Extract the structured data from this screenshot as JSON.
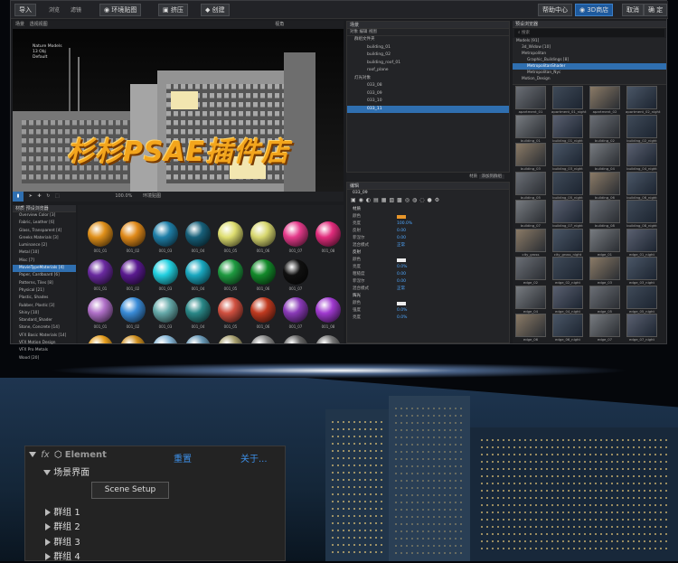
{
  "topbar": {
    "import": "导入",
    "browse": "浏览",
    "filter": "滤镜",
    "env": "环境贴图",
    "extrude": "挤压",
    "create": "创建",
    "help": "帮助中心",
    "store": "3D商店",
    "cancel": "取消",
    "ok": "确 定"
  },
  "viewport": {
    "tab": "场景",
    "mode": "透视视图",
    "bar": "视角",
    "zoom": "100.0%",
    "env": "环境贴图",
    "info1": "Nature Models",
    "info2": "13 Obj",
    "info3": "Default",
    "banner": "杉杉PSAE插件店",
    "colors": {
      "banner": "#f3a51c",
      "accent": "#2f6fb0"
    }
  },
  "matlist": {
    "tabs": [
      "材质",
      "预设浏览器"
    ],
    "items": [
      "Overview Color [3]",
      "Fabric, Leather [6]",
      "Glass, Transparent [4]",
      "Greeks Materials [3]",
      "Luminance [2]",
      "Metal [10]",
      "Misc [7]",
      "MovieTypeMaterials [4]",
      "Paper, Cardboard [6]",
      "Patterns, Tiles [8]",
      "Physical [21]",
      "Plastic, Shades",
      "Rubber, Plastic [3]",
      "Shiny [10]",
      "Standard_Shader",
      "Stone, Concrete [14]",
      "VFX Basic Materials [14]",
      "VFX Motion Design",
      "VFX Pro Metals",
      "Wood [20]"
    ],
    "selected": 7
  },
  "swatches": {
    "rows": [
      [
        "#e0901a",
        "#e08a1a",
        "#1f7fa8",
        "#17607a",
        "#dede70",
        "#d8d870",
        "#e43a8a",
        "#e12c7c"
      ],
      [
        "#6a2aa0",
        "#5a1a90",
        "#22d0e0",
        "#1aa8c0",
        "#1e9a40",
        "#138a2a",
        "#101010"
      ],
      [
        "#b070c8",
        "#3a8cd8",
        "#66aaaa",
        "#2a8888",
        "#d05040",
        "#c03a20",
        "#8a3ab8",
        "#a03ad0"
      ],
      [
        "#e8a020",
        "#d09020",
        "#88b8d8",
        "#6a9ab8",
        "#a8a070",
        "#888",
        "#666",
        "#777"
      ]
    ],
    "labels": [
      "001_01",
      "001_02",
      "001_03",
      "001_04",
      "001_05",
      "001_06",
      "001_07",
      "001_08"
    ]
  },
  "scene": {
    "title": "场景",
    "tabs": [
      "对象",
      "编辑",
      "视图"
    ],
    "items": [
      "群组文件夹",
      "building_01",
      "building_02",
      "building_roof_01",
      "roof_plane",
      "灯光对象",
      "033_08",
      "033_09",
      "033_10",
      "033_11"
    ],
    "selected": 9,
    "status": [
      "材质",
      "添加到群组"
    ]
  },
  "props": {
    "title": "编辑",
    "object": "033_09",
    "sec1": "材质",
    "rows1": [
      "颜色",
      "亮度",
      "反射",
      "菲涅尔",
      "混合模式"
    ],
    "vals1": [
      "",
      "100.0%",
      "0.00",
      "0.00",
      "正常"
    ],
    "sec2": "反射",
    "rows2": [
      "颜色",
      "亮度",
      "粗糙度",
      "菲涅尔",
      "混合模式"
    ],
    "vals2": [
      "",
      "0.0%",
      "0.00",
      "0.00",
      "正常"
    ],
    "sec3": "辉光",
    "rows3": [
      "颜色",
      "强度",
      "亮度"
    ],
    "vals3": [
      "",
      "0.0%",
      "0.0%"
    ]
  },
  "library": {
    "title": "预设浏览器",
    "search": "搜索",
    "tree": [
      "Models [91]",
      "3d_Widow [10]",
      "Metropolitan",
      "Graphic_Buildings [8]",
      "MetropolitanShader",
      "Metropolitan_Nyc",
      "Motion_Design"
    ],
    "selected": 4,
    "thumbs": [
      "apartment_01",
      "apartment_01_night",
      "apartment_02",
      "apartment_02_night",
      "building_01",
      "building_01_night",
      "building_02",
      "building_02_night",
      "building_03",
      "building_03_night",
      "building_04",
      "building_04_night",
      "building_05",
      "building_05_night",
      "building_06",
      "building_06_night",
      "building_07",
      "building_07_night",
      "building_08",
      "building_08_night",
      "city_gross",
      "city_gross_night",
      "edge_01",
      "edge_01_night",
      "edge_02",
      "edge_02_night",
      "edge_03",
      "edge_03_night",
      "edge_04",
      "edge_04_night",
      "edge_05",
      "edge_05_night",
      "edge_06",
      "edge_06_night",
      "edge_07",
      "edge_07_night"
    ]
  },
  "ae": {
    "fx": "fx",
    "name": "Element",
    "reset": "重置",
    "about": "关于...",
    "scene": "场景界面",
    "setup": "Scene Setup",
    "groups": [
      "群组  1",
      "群组  2",
      "群组  3",
      "群组  4"
    ]
  }
}
